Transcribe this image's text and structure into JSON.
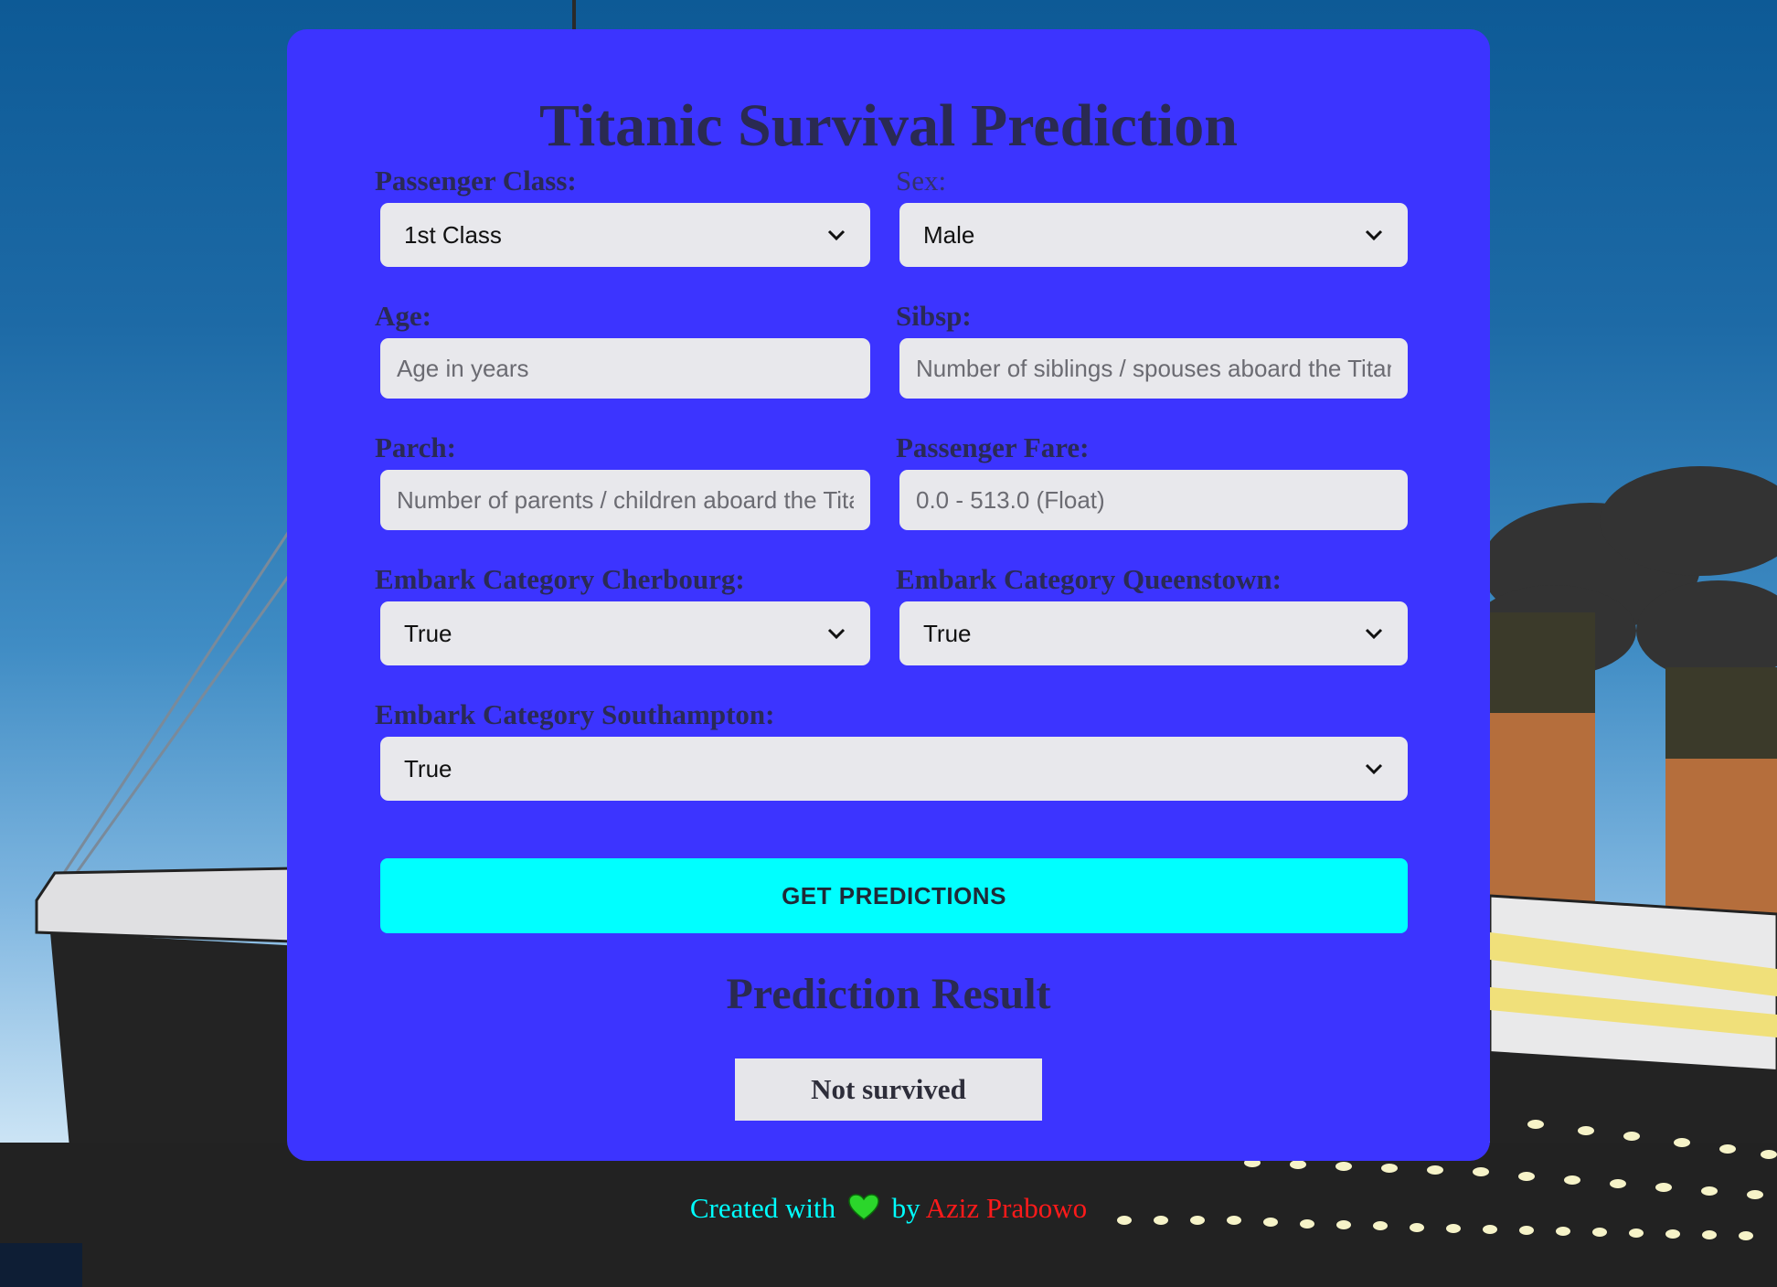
{
  "page": {
    "title": "Titanic Survival Prediction"
  },
  "form": {
    "passenger_class": {
      "label": "Passenger Class:",
      "value": "1st Class"
    },
    "sex": {
      "label": "Sex:",
      "value": "Male"
    },
    "age": {
      "label": "Age:",
      "placeholder": "Age in years"
    },
    "sibsp": {
      "label": "Sibsp:",
      "placeholder": "Number of siblings / spouses aboard the Titan"
    },
    "parch": {
      "label": "Parch:",
      "placeholder": "Number of parents / children aboard the Tita"
    },
    "fare": {
      "label": "Passenger Fare:",
      "placeholder": "0.0 - 513.0 (Float)"
    },
    "embark_cherbourg": {
      "label": "Embark Category Cherbourg:",
      "value": "True"
    },
    "embark_queenstown": {
      "label": "Embark Category Queenstown:",
      "value": "True"
    },
    "embark_southampton": {
      "label": "Embark Category Southampton:",
      "value": "True"
    },
    "submit_label": "GET PREDICTIONS"
  },
  "result": {
    "title": "Prediction Result",
    "value": "Not survived"
  },
  "footer": {
    "created_with": "Created with",
    "by": "by",
    "author": "Aziz Prabowo",
    "heart_icon": "green-heart-icon"
  },
  "colors": {
    "card_background": "#3c34ff",
    "button_background": "#00ffff",
    "footer_text": "#00ffff",
    "author_text": "#ff1a1a"
  }
}
